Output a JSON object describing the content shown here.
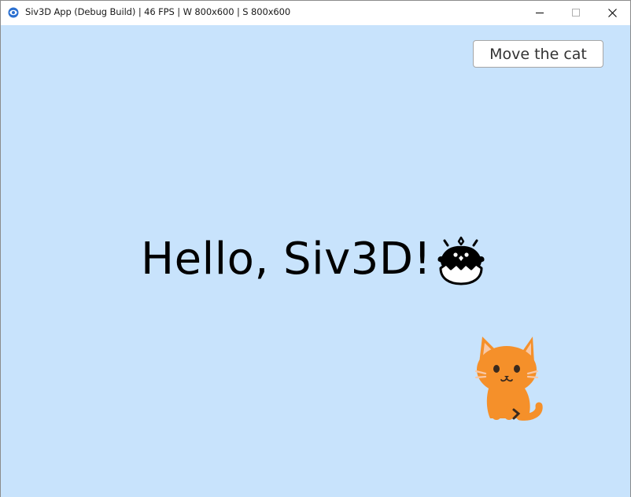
{
  "window": {
    "title": "Siv3D App (Debug Build) | 46 FPS | W 800x600 | S 800x600",
    "icon": "siv3d-app-icon",
    "controls": [
      "minimize-icon",
      "maximize-icon",
      "close-icon"
    ]
  },
  "canvas": {
    "background": "#c8e3fc",
    "button": {
      "label": "Move the cat"
    },
    "greeting": {
      "text": "Hello, Siv3D!",
      "emoji": "hatching-chick-icon"
    },
    "cat": {
      "emoji": "cat-icon",
      "color": "#f5902a"
    }
  }
}
